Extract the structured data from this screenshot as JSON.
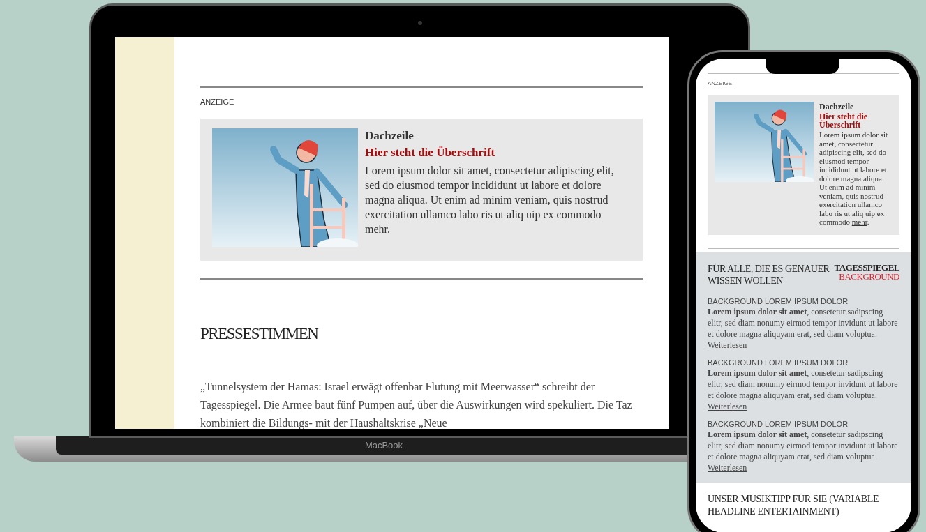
{
  "laptop": {
    "brand_label": "MacBook",
    "page": {
      "ad_label": "ANZEIGE",
      "ad": {
        "kicker": "Dachzeile",
        "headline": "Hier steht die Überschrift",
        "body": "Lorem ipsum dolor sit amet, consectetur adipiscing elit, sed do eiusmod tempor incididunt ut labore et dolore magna aliqua. Ut enim ad minim veniam, quis nostrud exercitation ullamco labo ris ut aliq uip ex commodo",
        "link": "mehr",
        "after_link": "."
      },
      "section_title": "PRESSESTIMMEN",
      "paragraph": "„Tunnelsystem der Hamas: Israel erwägt offenbar Flutung mit Meerwasser“ schreibt der Tagesspiegel. Die Armee baut fünf Pumpen auf, über die Auswirkungen wird spekuliert. Die Taz kombiniert die Bildungs- mit der Haushaltskrise „Neue"
    }
  },
  "phone": {
    "ad_label": "ANZEIGE",
    "ad": {
      "kicker": "Dachzeile",
      "headline": "Hier steht die Überschrift",
      "body": "Lorem ipsum dolor sit amet, consectetur adipiscing elit, sed do eiusmod tempor incididunt ut labore et dolore magna aliqua. Ut enim ad minim veniam, quis nostrud exercitation ullamco labo ris ut aliq uip ex commodo",
      "link": "mehr",
      "after_link": "."
    },
    "background_box": {
      "title": "FÜR ALLE, DIE ES GENAUER WISSEN WOLLEN",
      "logo_line_1": "TAGESSPIEGEL",
      "logo_line_2": "BACKGROUND",
      "items": [
        {
          "kicker": "BACKGROUND LOREM IPSUM DOLOR",
          "text": "**Lorem ipsum dolor sit amet**, consetetur sadipscing elitr, sed diam nonumy eirmod tempor invidunt ut labore et dolore magna aliquyam erat, sed diam voluptua.",
          "link": "Weiterlesen"
        },
        {
          "kicker": "BACKGROUND LOREM IPSUM DOLOR",
          "text": "**Lorem ipsum dolor sit amet**, consetetur sadipscing elitr, sed diam nonumy eirmod tempor invidunt ut labore et dolore magna aliquyam erat, sed diam voluptua.",
          "link": "Weiterlesen"
        },
        {
          "kicker": "BACKGROUND LOREM IPSUM DOLOR",
          "text": "**Lorem ipsum dolor sit amet**, consetetur sadipscing elitr, sed diam nonumy eirmod tempor invidunt ut labore et dolore magna aliquyam erat, sed diam voluptua.",
          "link": "Weiterlesen"
        }
      ]
    },
    "music_title": "UNSER MUSIKTIPP FÜR SIE (VARIABLE HEADLINE ENTERTAINMENT)"
  }
}
